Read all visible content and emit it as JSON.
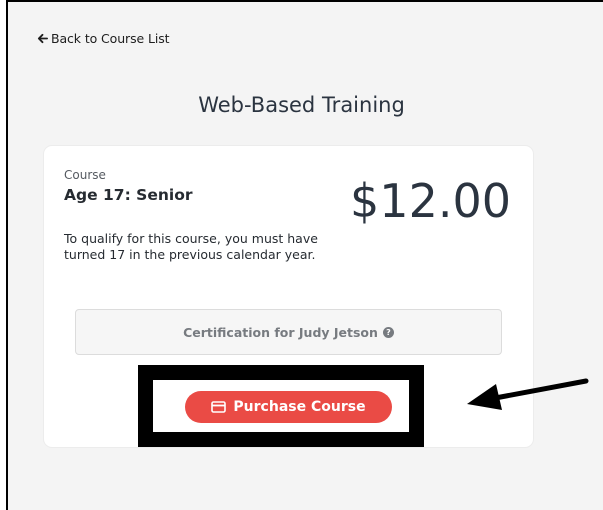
{
  "nav": {
    "back_label": "Back to Course List"
  },
  "page": {
    "title": "Web-Based Training"
  },
  "course": {
    "kicker": "Course",
    "name": "Age 17: Senior",
    "description": "To qualify for this course, you must have turned 17 in the previous calendar year.",
    "price": "$12.00"
  },
  "certification": {
    "label": "Certification for Judy Jetson",
    "help_glyph": "?"
  },
  "actions": {
    "purchase_label": "Purchase Course"
  },
  "colors": {
    "accent": "#ea4b45",
    "text_dark": "#2b3440",
    "muted": "#777b80",
    "annotation": "#000000"
  },
  "icons": {
    "back": "arrow-left-icon",
    "help": "question-circle-icon",
    "purchase": "credit-card-icon"
  }
}
